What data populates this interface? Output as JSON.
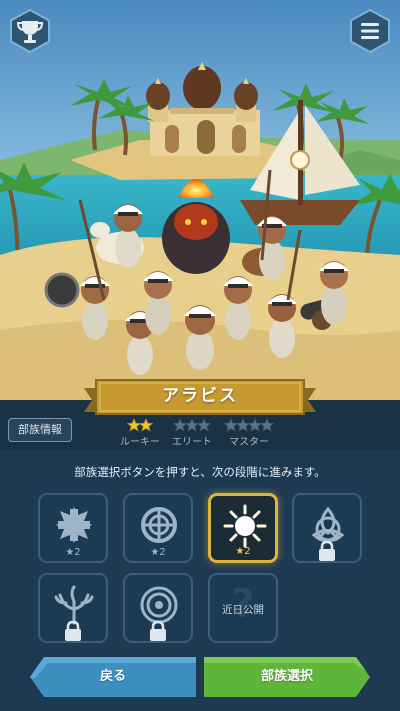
{
  "tribe": {
    "name": "アラビス"
  },
  "top_bar": {
    "trophy_icon": "trophy-icon",
    "menu_icon": "hamburger-menu-icon"
  },
  "info_button": {
    "label": "部族情報"
  },
  "ranks": [
    {
      "label": "ルーキー",
      "stars_filled": 2,
      "stars_total": 2
    },
    {
      "label": "エリート",
      "stars_filled": 0,
      "stars_total": 3
    },
    {
      "label": "マスター",
      "stars_filled": 0,
      "stars_total": 4
    }
  ],
  "instruction": "部族選択ボタンを押すと、次の段階に進みます。",
  "tribe_tiles": [
    {
      "emblem": "cross-emblem-icon",
      "star_count": "2",
      "locked": false,
      "selected": false
    },
    {
      "emblem": "knot-emblem-icon",
      "star_count": "2",
      "locked": false,
      "selected": false
    },
    {
      "emblem": "sun-emblem-icon",
      "star_count": "2",
      "locked": false,
      "selected": true
    },
    {
      "emblem": "triquetra-emblem-icon",
      "locked": true,
      "selected": false
    },
    {
      "emblem": "tree-emblem-icon",
      "locked": true,
      "selected": false
    },
    {
      "emblem": "spiral-emblem-icon",
      "locked": true,
      "selected": false
    },
    {
      "emblem": "question-icon",
      "label": "近日公開",
      "locked": false,
      "selected": false
    }
  ],
  "buttons": {
    "back": "戻る",
    "select": "部族選択"
  },
  "colors": {
    "gold": "#e2b53c",
    "back_blue": "#3d8fc0",
    "select_green": "#5fb53a",
    "panel": "#1d3a52"
  }
}
